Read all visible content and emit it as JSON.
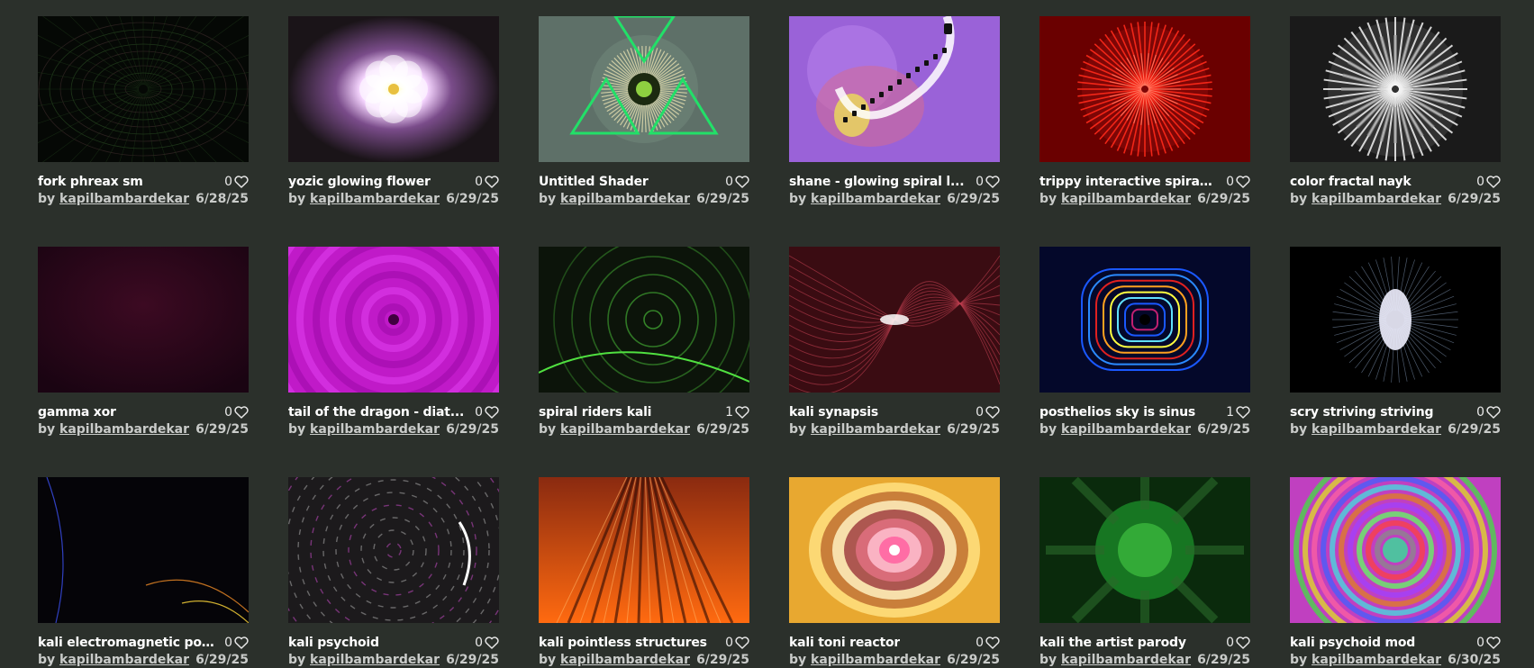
{
  "shaders": [
    {
      "title": "fork phreax sm",
      "author": "kapilbambardekar",
      "date": "6/28/25",
      "likes": "0",
      "by": "by",
      "thumb": "dark-kaleido"
    },
    {
      "title": "yozic glowing flower",
      "author": "kapilbambardekar",
      "date": "6/29/25",
      "likes": "0",
      "by": "by",
      "thumb": "glow-flower"
    },
    {
      "title": "Untitled Shader",
      "author": "kapilbambardekar",
      "date": "6/29/25",
      "likes": "0",
      "by": "by",
      "thumb": "green-eye"
    },
    {
      "title": "shane - glowing spiral l...",
      "author": "kapilbambardekar",
      "date": "6/29/25",
      "likes": "0",
      "by": "by",
      "thumb": "purple-spiral"
    },
    {
      "title": "trippy interactive spiral...",
      "author": "kapilbambardekar",
      "date": "6/29/25",
      "likes": "0",
      "by": "by",
      "thumb": "red-burst"
    },
    {
      "title": "color fractal nayk",
      "author": "kapilbambardekar",
      "date": "6/29/25",
      "likes": "0",
      "by": "by",
      "thumb": "white-fractal"
    },
    {
      "title": "gamma xor",
      "author": "kapilbambardekar",
      "date": "6/29/25",
      "likes": "0",
      "by": "by",
      "thumb": "dark-red"
    },
    {
      "title": "tail of the dragon - diat...",
      "author": "kapilbambardekar",
      "date": "6/29/25",
      "likes": "0",
      "by": "by",
      "thumb": "magenta-swirl"
    },
    {
      "title": "spiral riders kali",
      "author": "kapilbambardekar",
      "date": "6/29/25",
      "likes": "1",
      "by": "by",
      "thumb": "green-spirals"
    },
    {
      "title": "kali synapsis",
      "author": "kapilbambardekar",
      "date": "6/29/25",
      "likes": "0",
      "by": "by",
      "thumb": "red-synapse"
    },
    {
      "title": "posthelios sky is sinus",
      "author": "kapilbambardekar",
      "date": "6/29/25",
      "likes": "1",
      "by": "by",
      "thumb": "blue-mandala"
    },
    {
      "title": "scry striving striving",
      "author": "kapilbambardekar",
      "date": "6/29/25",
      "likes": "0",
      "by": "by",
      "thumb": "white-core"
    },
    {
      "title": "kali electromagnetic po...",
      "author": "kapilbambardekar",
      "date": "6/29/25",
      "likes": "0",
      "by": "by",
      "thumb": "dark-lines"
    },
    {
      "title": "kali psychoid",
      "author": "kapilbambardekar",
      "date": "6/29/25",
      "likes": "0",
      "by": "by",
      "thumb": "gray-tunnel"
    },
    {
      "title": "kali pointless structures",
      "author": "kapilbambardekar",
      "date": "6/29/25",
      "likes": "0",
      "by": "by",
      "thumb": "orange-rays"
    },
    {
      "title": "kali toni reactor",
      "author": "kapilbambardekar",
      "date": "6/29/25",
      "likes": "0",
      "by": "by",
      "thumb": "gold-reactor"
    },
    {
      "title": "kali the artist parody",
      "author": "kapilbambardekar",
      "date": "6/29/25",
      "likes": "0",
      "by": "by",
      "thumb": "green-fractal"
    },
    {
      "title": "kali psychoid mod",
      "author": "kapilbambardekar",
      "date": "6/30/25",
      "likes": "0",
      "by": "by",
      "thumb": "rainbow-tunnel"
    }
  ],
  "colors": {
    "background": "#2b302b",
    "text": "#ffffff",
    "muted": "#c9cbc9"
  }
}
